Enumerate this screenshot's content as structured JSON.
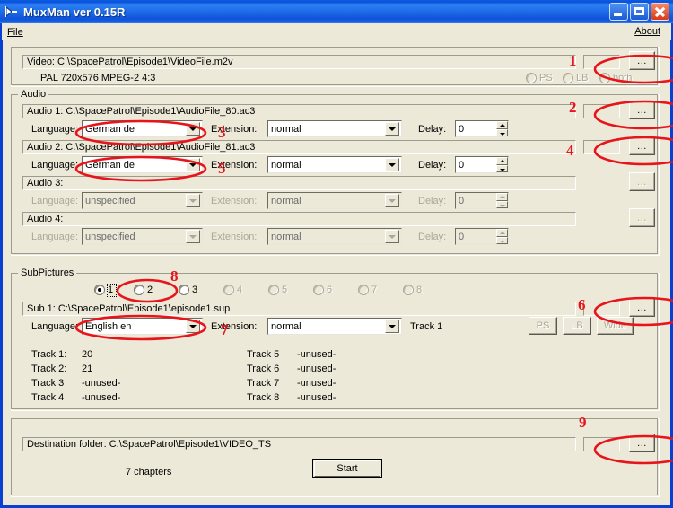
{
  "window": {
    "title": "MuxMan ver 0.15R",
    "icon": "app-icon",
    "buttons": {
      "minimize": "minimize",
      "maximize": "maximize",
      "close": "close"
    }
  },
  "menubar": {
    "file": "File",
    "about": "About"
  },
  "video": {
    "path_label": "Video: C:\\SpacePatrol\\Episode1\\VideoFile.m2v",
    "info": "PAL  720x576  MPEG-2  4:3",
    "aspect_options": [
      "PS",
      "LB",
      "both"
    ],
    "browse_label": "...",
    "browse_field": ""
  },
  "audio": {
    "group_label": "Audio",
    "language_label": "Language:",
    "extension_label": "Extension:",
    "delay_label": "Delay:",
    "browse_label": "...",
    "tracks": [
      {
        "path_label": "Audio 1: C:\\SpacePatrol\\Episode1\\AudioFile_80.ac3",
        "language": "German de",
        "extension": "normal",
        "delay": "0",
        "enabled": true
      },
      {
        "path_label": "Audio 2: C:\\SpacePatrol\\Episode1\\AudioFile_81.ac3",
        "language": "German de",
        "extension": "normal",
        "delay": "0",
        "enabled": true
      },
      {
        "path_label": "Audio 3:",
        "language": "unspecified",
        "extension": "normal",
        "delay": "0",
        "enabled": false
      },
      {
        "path_label": "Audio 4:",
        "language": "unspecified",
        "extension": "normal",
        "delay": "0",
        "enabled": false
      }
    ]
  },
  "subpictures": {
    "group_label": "SubPictures",
    "stream_radios": [
      "1",
      "2",
      "3",
      "4",
      "5",
      "6",
      "7",
      "8"
    ],
    "selected_stream": "1",
    "path_label": "Sub 1: C:\\SpacePatrol\\Episode1\\episode1.sup",
    "language_label": "Language:",
    "language": "English en",
    "extension_label": "Extension:",
    "extension": "normal",
    "track_label": "Track 1",
    "view_buttons": [
      "PS",
      "LB",
      "Wide"
    ],
    "browse_label": "...",
    "tracks_left": [
      {
        "name": "Track 1:",
        "value": "20"
      },
      {
        "name": "Track 2:",
        "value": "21"
      },
      {
        "name": "Track 3",
        "value": "-unused-"
      },
      {
        "name": "Track 4",
        "value": "-unused-"
      }
    ],
    "tracks_right": [
      {
        "name": "Track 5",
        "value": "-unused-"
      },
      {
        "name": "Track 6",
        "value": "-unused-"
      },
      {
        "name": "Track 7",
        "value": "-unused-"
      },
      {
        "name": "Track 8",
        "value": "-unused-"
      }
    ]
  },
  "destination": {
    "label": "Destination folder: C:\\SpacePatrol\\Episode1\\VIDEO_TS",
    "browse_label": "...",
    "browse_field": ""
  },
  "footer": {
    "chapters": "7 chapters",
    "start_label": "Start"
  },
  "annotations": {
    "color": "#e8141c",
    "numbers": [
      "1",
      "2",
      "3",
      "4",
      "5",
      "6",
      "7",
      "8",
      "9"
    ]
  }
}
